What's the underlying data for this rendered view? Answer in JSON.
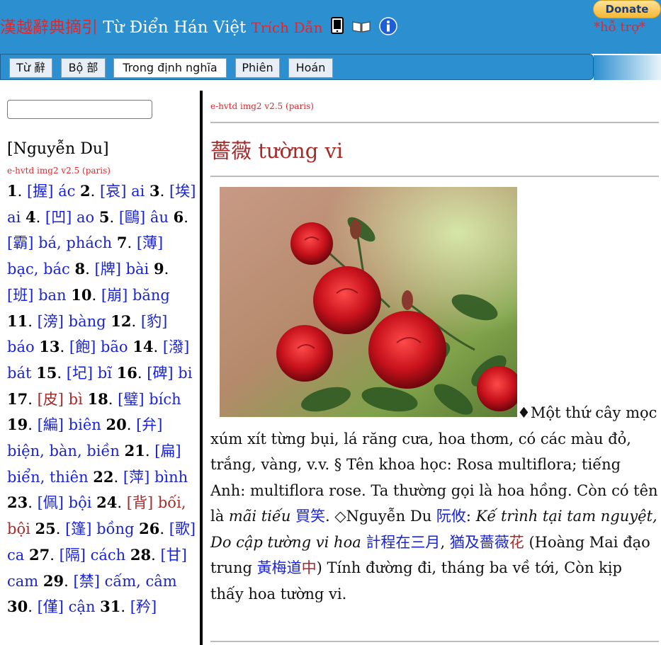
{
  "header": {
    "title_han": "漢越辭典摘引",
    "title_viet": "Từ Điển Hán Việt",
    "title_trich": "Trích Dẫn",
    "icons": [
      "mobile-phone-icon",
      "book-icon",
      "info-icon"
    ],
    "donate_label": "Donate",
    "support_label": "*hỗ trợ*"
  },
  "tabs": [
    {
      "label": "Từ 辭"
    },
    {
      "label": "Bộ 部"
    },
    {
      "label": "Trong định nghĩa"
    },
    {
      "label": "Phiên"
    },
    {
      "label": "Hoán"
    }
  ],
  "search": {
    "value": ""
  },
  "sidebar": {
    "title": "[Nguyễn Du]",
    "version": "e-hvtd img2 v2.5 (paris)",
    "entries": [
      {
        "n": "1",
        "han": "握",
        "reading": "ác"
      },
      {
        "n": "2",
        "han": "哀",
        "reading": "ai"
      },
      {
        "n": "3",
        "han": "埃",
        "reading": "ai"
      },
      {
        "n": "4",
        "han": "凹",
        "reading": "ao"
      },
      {
        "n": "5",
        "han": "鷗",
        "reading": "âu"
      },
      {
        "n": "6",
        "han": "霸",
        "reading": "bá, phách"
      },
      {
        "n": "7",
        "han": "薄",
        "reading": "bạc, bác"
      },
      {
        "n": "8",
        "han": "牌",
        "reading": "bài"
      },
      {
        "n": "9",
        "han": "班",
        "reading": "ban"
      },
      {
        "n": "10",
        "han": "崩",
        "reading": "băng"
      },
      {
        "n": "11",
        "han": "滂",
        "reading": "bàng"
      },
      {
        "n": "12",
        "han": "豹",
        "reading": "báo"
      },
      {
        "n": "13",
        "han": "飽",
        "reading": "bão"
      },
      {
        "n": "14",
        "han": "潑",
        "reading": "bát"
      },
      {
        "n": "15",
        "han": "圮",
        "reading": "bĩ"
      },
      {
        "n": "16",
        "han": "碑",
        "reading": "bi"
      },
      {
        "n": "17",
        "han": "皮",
        "reading": "bì",
        "visited": true
      },
      {
        "n": "18",
        "han": "璧",
        "reading": "bích"
      },
      {
        "n": "19",
        "han": "編",
        "reading": "biên"
      },
      {
        "n": "20",
        "han": "弁",
        "reading": "biện, bàn, biền"
      },
      {
        "n": "21",
        "han": "扁",
        "reading": "biển, thiên"
      },
      {
        "n": "22",
        "han": "萍",
        "reading": "bình"
      },
      {
        "n": "23",
        "han": "佩",
        "reading": "bội"
      },
      {
        "n": "24",
        "han": "背",
        "reading": "bối, bội",
        "visited": true
      },
      {
        "n": "25",
        "han": "篷",
        "reading": "bồng"
      },
      {
        "n": "26",
        "han": "歌",
        "reading": "ca"
      },
      {
        "n": "27",
        "han": "隔",
        "reading": "cách"
      },
      {
        "n": "28",
        "han": "甘",
        "reading": "cam"
      },
      {
        "n": "29",
        "han": "禁",
        "reading": "cấm, câm"
      },
      {
        "n": "30",
        "han": "僅",
        "reading": "cận"
      },
      {
        "n": "31",
        "han": "矜",
        "reading": ""
      }
    ]
  },
  "main": {
    "version": "e-hvtd img2 v2.5 (paris)",
    "headword_han": "薔薇",
    "headword_reading": "tường vi",
    "image_alt": "red rose flowers photo",
    "definition": {
      "bullet": "♦",
      "p1": "Một thứ cây mọc xúm xít từng bụi, lá răng cưa, hoa thơm, có các màu đỏ, trắng, vàng, v.v. § Tên khoa học: Rosa multiflora; tiếng Anh: multiflora rose. Ta thường gọi là hoa hồng. Còn có tên là ",
      "i1": "mãi tiếu",
      "h1": "買笑",
      "p2": ". ◇Nguyễn Du ",
      "h2": "阮攸",
      "p3": ": ",
      "i2": "Kế trình tại tam nguyệt, Do cập tường vi hoa",
      "p4": " ",
      "h3": "計程在三月",
      "p5": ", ",
      "h4a": "猶及薔薇",
      "h4b": "花",
      "p6": " (Hoàng Mai đạo trung ",
      "h5a": "黃梅道",
      "h5b": "中",
      "p7": ") Tính đường đi, tháng ba về tới, Còn kịp thấy hoa tường vi."
    }
  }
}
